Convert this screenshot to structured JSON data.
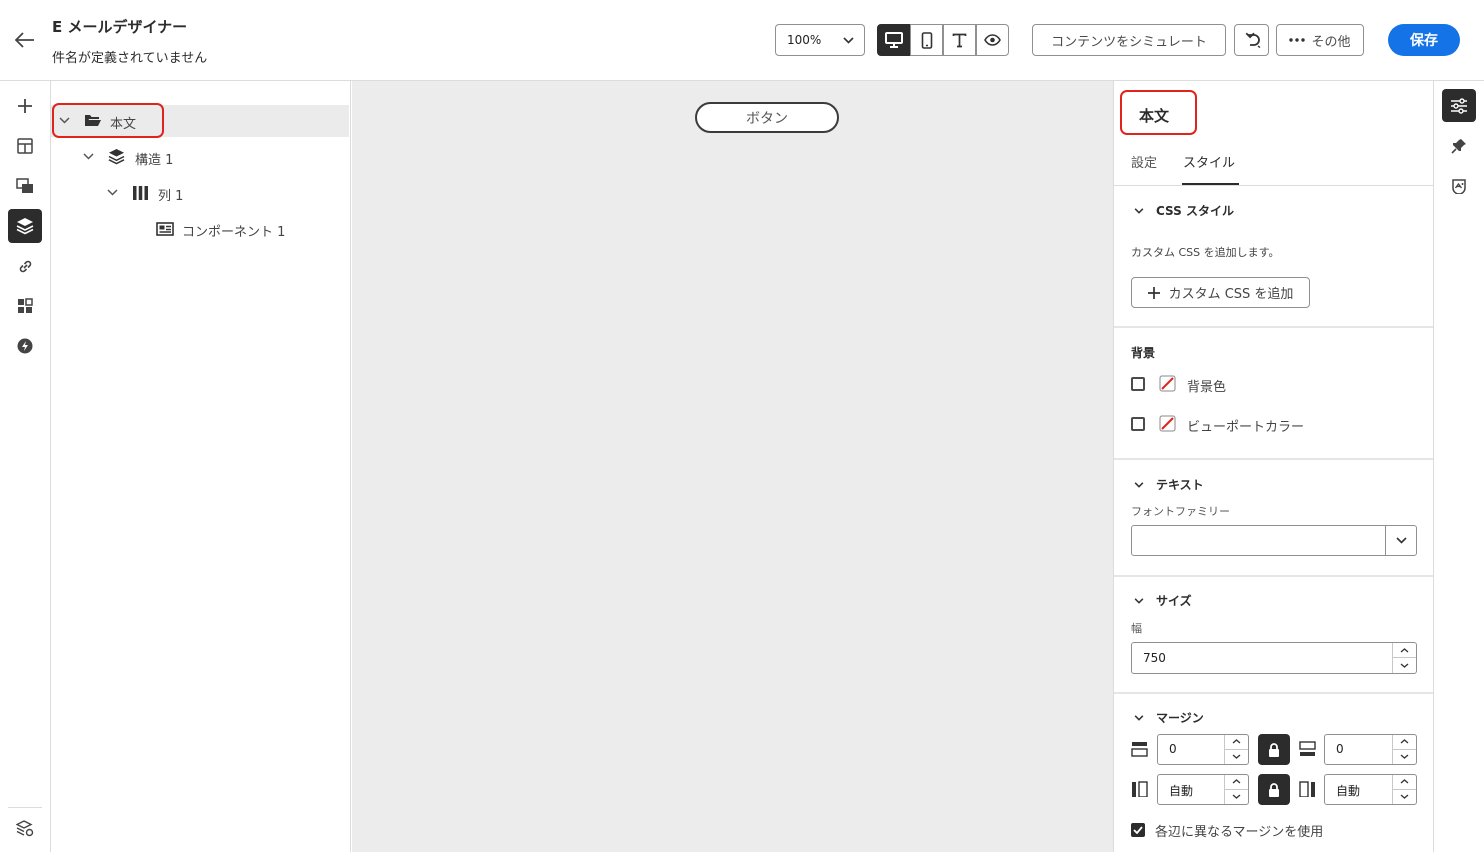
{
  "header": {
    "title": "E メールデザイナー",
    "subtitle": "件名が定義されていません",
    "zoom": "100%",
    "simulate_label": "コンテンツをシミュレート",
    "more_label": "その他",
    "save_label": "保存"
  },
  "tree": {
    "items": [
      {
        "label": "本文"
      },
      {
        "label": "構造 1"
      },
      {
        "label": "列 1"
      },
      {
        "label": "コンポーネント 1"
      }
    ]
  },
  "canvas": {
    "button_label": "ボタン"
  },
  "props": {
    "title": "本文",
    "tabs": [
      {
        "label": "設定"
      },
      {
        "label": "スタイル"
      }
    ],
    "active_tab": "スタイル",
    "css": {
      "title": "CSS スタイル",
      "desc": "カスタム CSS を追加します。",
      "add_label": "カスタム CSS を追加"
    },
    "background": {
      "title": "背景",
      "bg_color_label": "背景色",
      "viewport_label": "ビューポートカラー"
    },
    "text": {
      "title": "テキスト",
      "font_label": "フォントファミリー",
      "font_value": ""
    },
    "size": {
      "title": "サイズ",
      "width_label": "幅",
      "width_value": "750"
    },
    "margin": {
      "title": "マージン",
      "top": "0",
      "bottom": "0",
      "left": "自動",
      "right": "自動",
      "diff_label": "各辺に異なるマージンを使用",
      "diff_checked": true
    }
  },
  "colors": {
    "accent": "#1473e6",
    "highlight": "#e0241c",
    "canvas_bg": "#ececec"
  }
}
